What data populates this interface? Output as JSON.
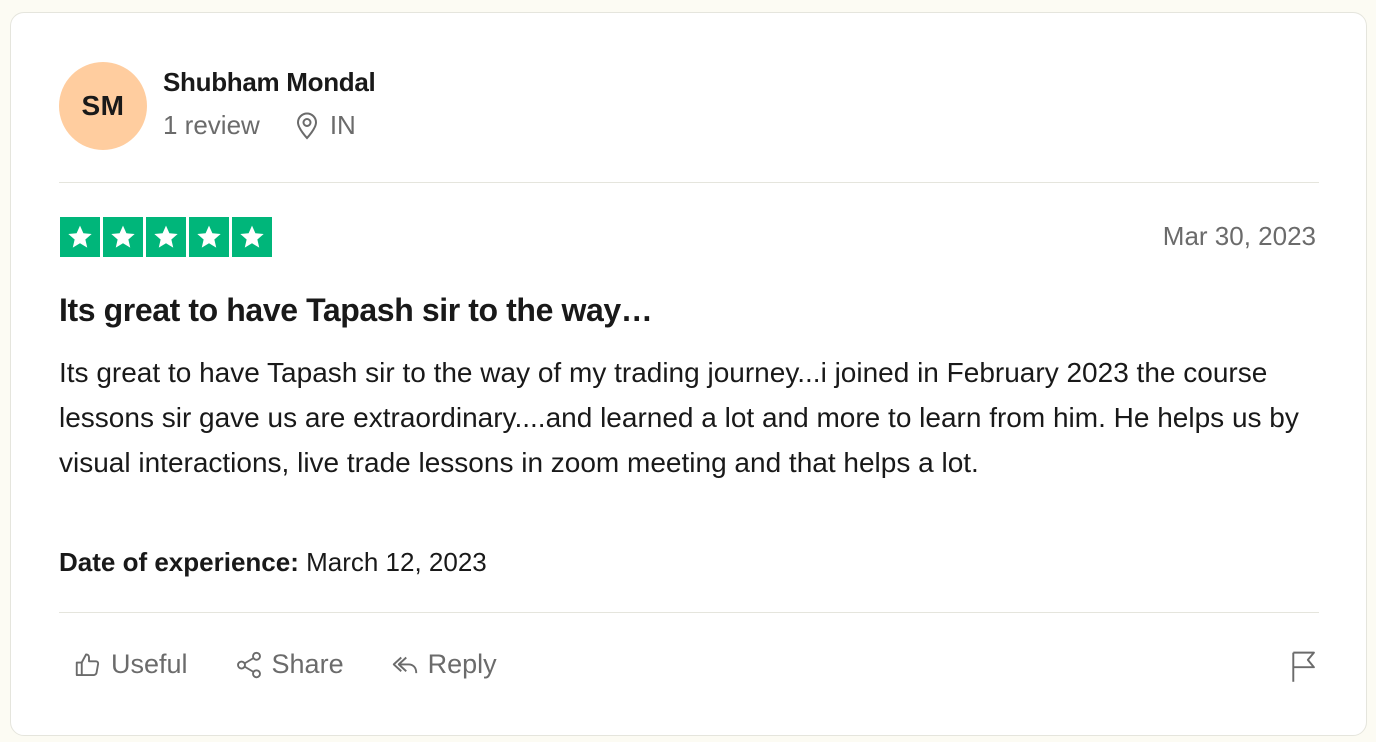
{
  "reviewer": {
    "initials": "SM",
    "name": "Shubham Mondal",
    "review_count": "1 review",
    "country": "IN",
    "avatar_color": "#ffcd9f"
  },
  "review": {
    "rating": 5,
    "rating_max": 5,
    "star_color": "#00b67a",
    "date": "Mar 30, 2023",
    "title": "Its great to have Tapash sir to the way…",
    "body": "Its great to have Tapash sir to the way of my trading journey...i joined in February 2023 the course lessons sir gave us are extraordinary....and learned a lot and more to learn from him. He helps us by visual interactions, live trade lessons in zoom meeting and that helps a lot.",
    "experience_label": "Date of experience:",
    "experience_date": " March 12, 2023"
  },
  "actions": {
    "useful_label": "Useful",
    "share_label": "Share",
    "reply_label": "Reply",
    "useful_icon": "thumbs-up-icon",
    "share_icon": "share-icon",
    "reply_icon": "reply-icon",
    "flag_icon": "flag-icon"
  }
}
